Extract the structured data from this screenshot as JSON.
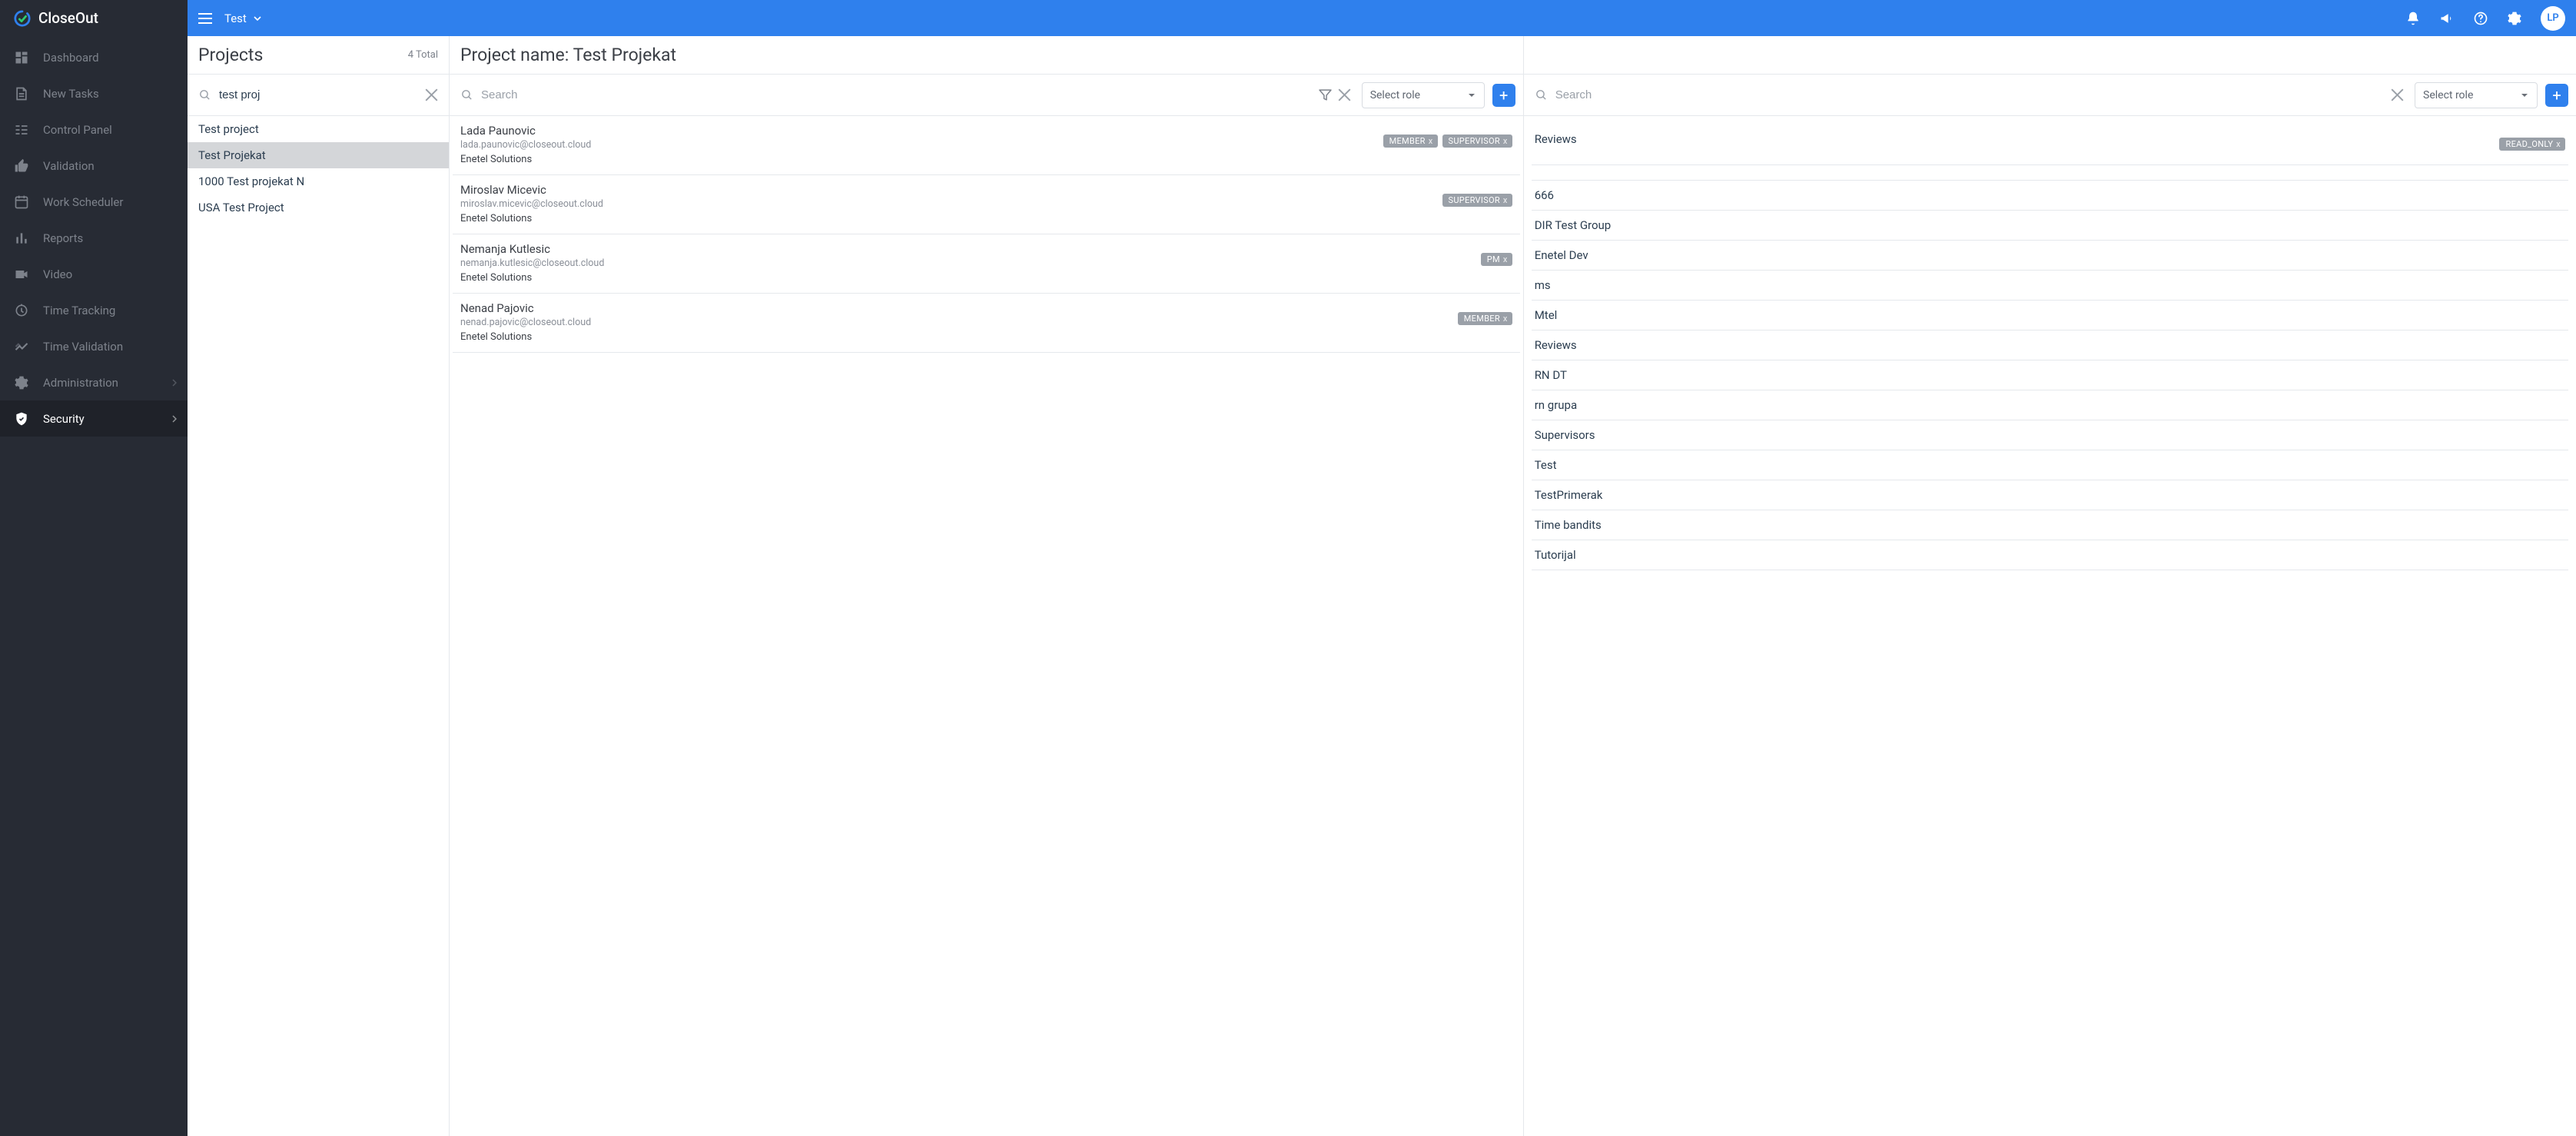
{
  "brand": "CloseOut",
  "topbar": {
    "tenant": "Test",
    "avatar_initials": "LP"
  },
  "sidebar": {
    "items": [
      {
        "key": "dashboard",
        "label": "Dashboard"
      },
      {
        "key": "new-tasks",
        "label": "New Tasks"
      },
      {
        "key": "control-panel",
        "label": "Control Panel"
      },
      {
        "key": "validation",
        "label": "Validation"
      },
      {
        "key": "work-scheduler",
        "label": "Work Scheduler"
      },
      {
        "key": "reports",
        "label": "Reports"
      },
      {
        "key": "video",
        "label": "Video"
      },
      {
        "key": "time-tracking",
        "label": "Time Tracking"
      },
      {
        "key": "time-validation",
        "label": "Time Validation"
      },
      {
        "key": "administration",
        "label": "Administration",
        "has_children": true
      },
      {
        "key": "security",
        "label": "Security",
        "has_children": true,
        "active": true
      }
    ]
  },
  "projects": {
    "title": "Projects",
    "total_label": "4 Total",
    "search_value": "test proj",
    "items": [
      {
        "label": "Test project"
      },
      {
        "label": "Test Projekat",
        "selected": true
      },
      {
        "label": "1000 Test projekat N"
      },
      {
        "label": "USA Test Project"
      }
    ]
  },
  "members": {
    "title_prefix": "Project name: ",
    "project_name": "Test Projekat",
    "search_placeholder": "Search",
    "role_select_label": "Select role",
    "items": [
      {
        "name": "Lada Paunovic",
        "email": "lada.paunovic@closeout.cloud",
        "company": "Enetel Solutions",
        "roles": [
          "MEMBER",
          "SUPERVISOR"
        ]
      },
      {
        "name": "Miroslav Micevic",
        "email": "miroslav.micevic@closeout.cloud",
        "company": "Enetel Solutions",
        "roles": [
          "SUPERVISOR"
        ]
      },
      {
        "name": "Nemanja Kutlesic",
        "email": "nemanja.kutlesic@closeout.cloud",
        "company": "Enetel Solutions",
        "roles": [
          "PM"
        ]
      },
      {
        "name": "Nenad Pajovic",
        "email": "nenad.pajovic@closeout.cloud",
        "company": "Enetel Solutions",
        "roles": [
          "MEMBER"
        ]
      }
    ]
  },
  "groups": {
    "search_placeholder": "Search",
    "role_select_label": "Select role",
    "header_group": {
      "name": "Reviews",
      "roles": [
        "READ_ONLY"
      ]
    },
    "items": [
      "666",
      "DIR Test Group",
      "Enetel Dev",
      "ms",
      "Mtel",
      "Reviews",
      "RN DT",
      "rn grupa",
      "Supervisors",
      "Test",
      "TestPrimerak",
      "Time bandits",
      "Tutorijal"
    ]
  }
}
